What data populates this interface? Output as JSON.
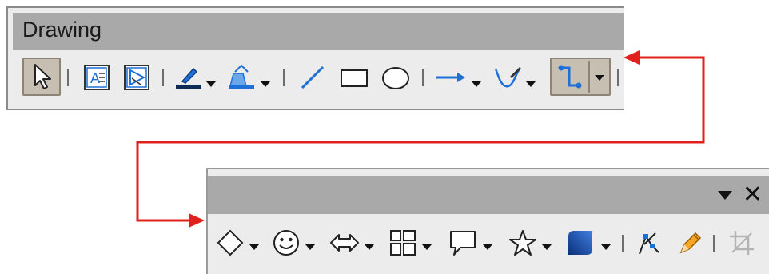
{
  "top_toolbar": {
    "title": "Drawing",
    "items": [
      {
        "name": "select-tool",
        "icon": "cursor-arrow-icon",
        "active": true
      },
      {
        "name": "insert-text-box",
        "icon": "text-box-icon"
      },
      {
        "name": "insert-fontwork",
        "icon": "fontwork-icon"
      },
      {
        "name": "line-color",
        "icon": "line-color-icon",
        "dropdown": true
      },
      {
        "name": "fill-color",
        "icon": "fill-color-icon",
        "dropdown": true
      },
      {
        "name": "line",
        "icon": "line-icon"
      },
      {
        "name": "rectangle",
        "icon": "rectangle-icon"
      },
      {
        "name": "ellipse",
        "icon": "ellipse-icon"
      },
      {
        "name": "lines-and-arrows",
        "icon": "arrow-line-icon",
        "dropdown": true
      },
      {
        "name": "curves-and-polygons",
        "icon": "curve-icon",
        "dropdown": true
      },
      {
        "name": "connectors",
        "icon": "connector-icon",
        "dropdown": true,
        "active": true
      }
    ]
  },
  "bottom_toolbar": {
    "items": [
      {
        "name": "basic-shapes",
        "icon": "diamond-icon",
        "dropdown": true
      },
      {
        "name": "symbol-shapes",
        "icon": "smiley-icon",
        "dropdown": true
      },
      {
        "name": "block-arrows",
        "icon": "double-arrow-icon",
        "dropdown": true
      },
      {
        "name": "flowchart",
        "icon": "flowchart-icon",
        "dropdown": true
      },
      {
        "name": "callouts",
        "icon": "callout-icon",
        "dropdown": true
      },
      {
        "name": "stars",
        "icon": "star-icon",
        "dropdown": true
      },
      {
        "name": "3d-objects",
        "icon": "cube-3d-icon",
        "dropdown": true
      },
      {
        "name": "points",
        "icon": "points-icon"
      },
      {
        "name": "toggle-extrusion",
        "icon": "pencil-icon"
      },
      {
        "name": "crop",
        "icon": "crop-icon",
        "disabled": true
      }
    ],
    "controls": [
      "toolbar-menu",
      "close"
    ]
  },
  "colors": {
    "accent_blue": "#1e6fd6",
    "arrow_red": "#e0201b",
    "title_bar": "#a9a9a9",
    "toolbar_bg": "#ececec",
    "active_button": "#c8bfb3"
  }
}
